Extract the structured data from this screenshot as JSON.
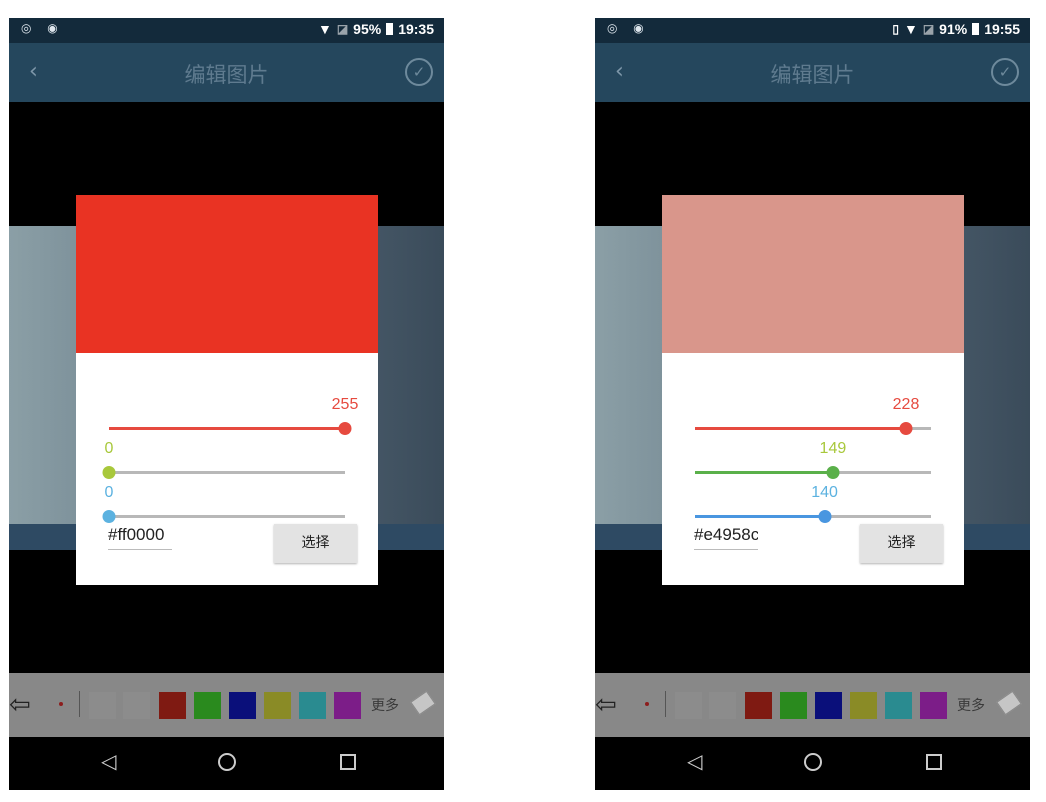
{
  "screens": [
    {
      "status": {
        "left_icons": "◎ ◉",
        "battery": "95%",
        "time": "19:35",
        "vibrate": ""
      },
      "app": {
        "title": "编辑图片"
      },
      "dialog": {
        "preview_color": "#e93323",
        "sliders": [
          {
            "name": "red",
            "value": "255",
            "value_num": 255,
            "color": "#e64a3f",
            "label_color": "#e64a3f"
          },
          {
            "name": "green",
            "value": "0",
            "value_num": 0,
            "color": "#a8c83b",
            "label_color": "#a8c83b"
          },
          {
            "name": "blue",
            "value": "0",
            "value_num": 0,
            "color": "#5cb2e0",
            "label_color": "#5cb2e0"
          }
        ],
        "hex_value": "#ff0000",
        "choose_label": "选择"
      },
      "toolbar": {
        "more_label": "更多"
      }
    },
    {
      "status": {
        "left_icons": "◎ ◉",
        "battery": "91%",
        "time": "19:55",
        "vibrate": "▯"
      },
      "app": {
        "title": "编辑图片"
      },
      "dialog": {
        "preview_color": "#d9968b",
        "sliders": [
          {
            "name": "red",
            "value": "228",
            "value_num": 228,
            "color": "#e64a3f",
            "label_color": "#e64a3f"
          },
          {
            "name": "green",
            "value": "149",
            "value_num": 149,
            "color": "#5ab04a",
            "label_color": "#a8c83b"
          },
          {
            "name": "blue",
            "value": "140",
            "value_num": 140,
            "color": "#4996e0",
            "label_color": "#5cb2e0"
          }
        ],
        "hex_value": "#e4958c",
        "choose_label": "选择"
      },
      "toolbar": {
        "more_label": "更多"
      }
    }
  ],
  "toolbar_swatches": [
    "#8c8c8c",
    "#8c8c8c",
    "#7f1a12",
    "#2a8a1e",
    "#0a0f7a",
    "#8a8b26",
    "#2a8b90",
    "#7c1d88"
  ]
}
